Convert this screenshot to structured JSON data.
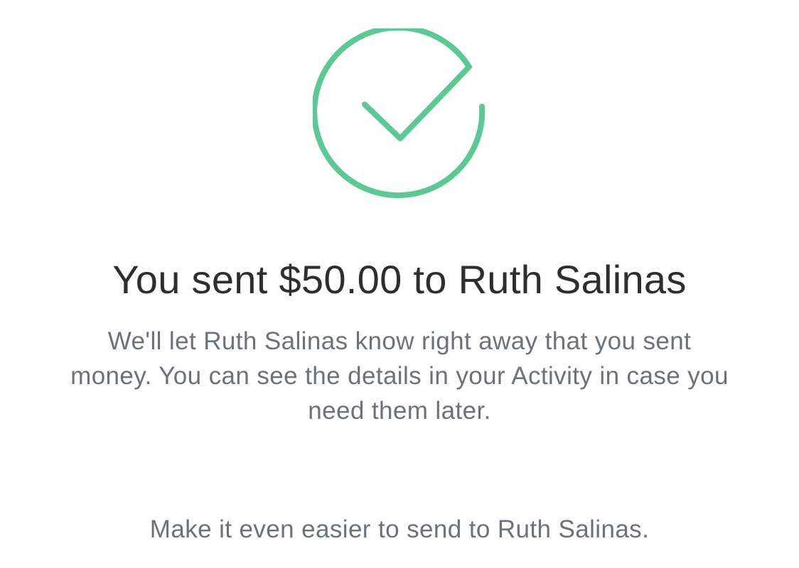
{
  "confirmation": {
    "icon": "checkmark-circle-icon",
    "accent_color": "#5bc994",
    "title": "You sent $50.00 to Ruth Salinas",
    "message": "We'll let Ruth Salinas know right away that you sent money. You can see the details in your Activity in case you need them later.",
    "easier_prompt": "Make it even easier to send to Ruth Salinas."
  }
}
